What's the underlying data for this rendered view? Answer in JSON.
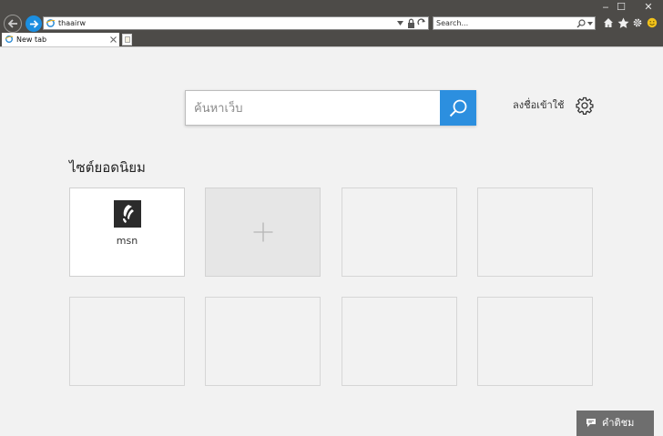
{
  "browser": {
    "window_controls": {
      "minimize": "‒",
      "maximize": "☐",
      "close": "✕"
    },
    "address_bar": {
      "value": "thaairw"
    },
    "search_box": {
      "placeholder": "Search..."
    },
    "tab": {
      "title": "New tab"
    }
  },
  "newtab": {
    "search": {
      "placeholder": "ค้นหาเว็บ"
    },
    "sign_in": "ลงชื่อเข้าใช้",
    "top_sites_heading": "ไซต์ยอดนิยม",
    "tiles": [
      {
        "label": "msn"
      }
    ],
    "feedback_label": "คำติชม"
  },
  "colors": {
    "titlebar": "#4d4b48",
    "accent": "#2c8fdf",
    "page_bg": "#f2f2f2"
  }
}
